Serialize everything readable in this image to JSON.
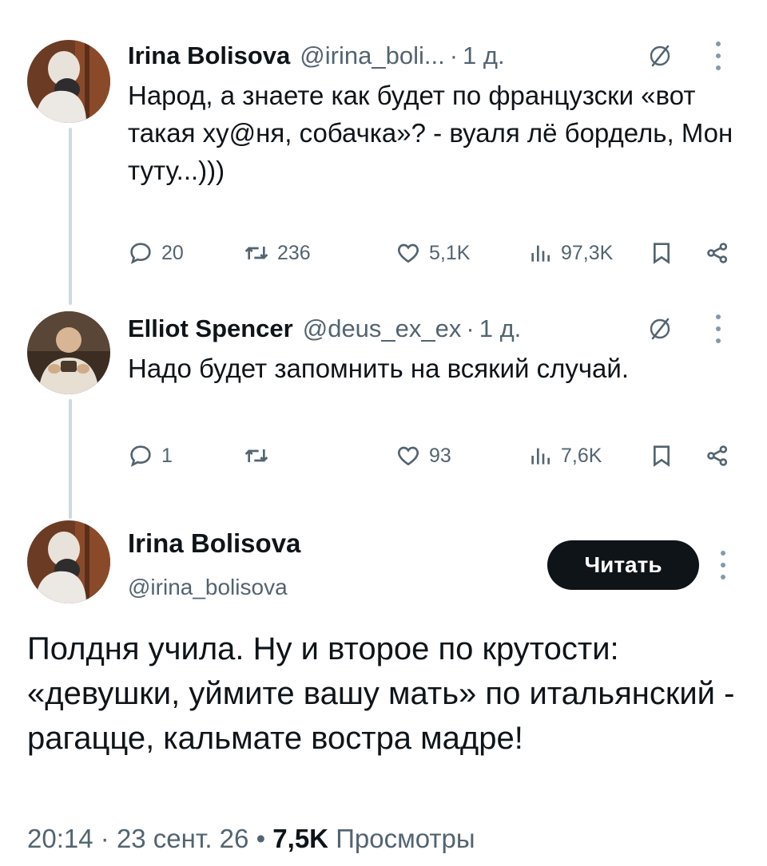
{
  "reply1": {
    "name": "Irina Bolisova",
    "handle": "@irina_boli...",
    "separator": "·",
    "time": "1 д.",
    "text": "Народ, а знаете как будет по французски «вот такая ху@ня, собачка»? - вуаля лё бордель, Мон туту...)))",
    "replies": "20",
    "retweets": "236",
    "likes": "5,1K",
    "views": "97,3K"
  },
  "reply2": {
    "name": "Elliot Spencer",
    "handle": "@deus_ex_ex",
    "separator": "·",
    "time": "1 д.",
    "text": "Надо будет запомнить на всякий случай.",
    "replies": "1",
    "retweets": "",
    "likes": "93",
    "views": "7,6K"
  },
  "main": {
    "name": "Irina Bolisova",
    "handle": "@irina_bolisova",
    "follow_label": "Читать",
    "text": "Полдня учила.  Ну и второе по крутости: «девушки, уймите вашу мать» по итальянский - рагацце, кальмате востра мадре!",
    "time": "20:14",
    "date": "23 сент. 26",
    "sep1": "·",
    "sep2": "•",
    "views_count": "7,5K",
    "views_label": "Просмотры"
  },
  "colors": {
    "text": "#0f1419",
    "muted": "#536471",
    "thread_line": "#cfd9de",
    "button_bg": "#0f1419"
  },
  "icons": [
    "avatar",
    "grok-icon",
    "more-icon",
    "reply-icon",
    "retweet-icon",
    "like-icon",
    "views-icon",
    "bookmark-icon",
    "share-icon"
  ]
}
